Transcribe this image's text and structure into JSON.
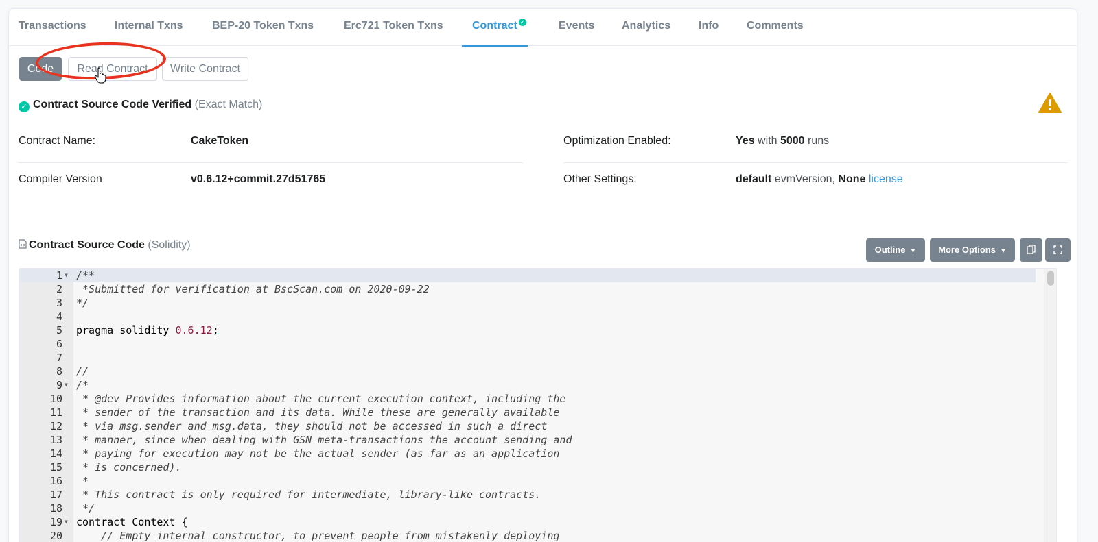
{
  "tabs": [
    {
      "label": "Transactions"
    },
    {
      "label": "Internal Txns"
    },
    {
      "label": "BEP-20 Token Txns"
    },
    {
      "label": "Erc721 Token Txns"
    },
    {
      "label": "Contract"
    },
    {
      "label": "Events"
    },
    {
      "label": "Analytics"
    },
    {
      "label": "Info"
    },
    {
      "label": "Comments"
    }
  ],
  "active_tab": "Contract",
  "sub_buttons": {
    "code": "Code",
    "read": "Read Contract",
    "write": "Write Contract"
  },
  "verified": {
    "title": "Contract Source Code Verified",
    "match": "(Exact Match)"
  },
  "info": {
    "contract_name_label": "Contract Name:",
    "contract_name": "CakeToken",
    "compiler_label": "Compiler Version",
    "compiler": "v0.6.12+commit.27d51765",
    "optimization_label": "Optimization Enabled:",
    "optimization_yes": "Yes",
    "optimization_with": "with",
    "optimization_runs": "5000",
    "optimization_runs_word": "runs",
    "other_label": "Other Settings:",
    "other_default": "default",
    "other_evm": "evmVersion,",
    "other_none": "None",
    "other_license": "license"
  },
  "source": {
    "title": "Contract Source Code",
    "lang": "(Solidity)",
    "outline": "Outline",
    "more_options": "More Options"
  },
  "code_lines": [
    {
      "n": "1",
      "text": "/**",
      "fold": true
    },
    {
      "n": "2",
      "text": " *Submitted for verification at BscScan.com on 2020-09-22"
    },
    {
      "n": "3",
      "text": "*/"
    },
    {
      "n": "4",
      "text": ""
    },
    {
      "n": "5",
      "text": "pragma solidity 0.6.12;"
    },
    {
      "n": "6",
      "text": ""
    },
    {
      "n": "7",
      "text": ""
    },
    {
      "n": "8",
      "text": "//"
    },
    {
      "n": "9",
      "text": "/*",
      "fold": true
    },
    {
      "n": "10",
      "text": " * @dev Provides information about the current execution context, including the"
    },
    {
      "n": "11",
      "text": " * sender of the transaction and its data. While these are generally available"
    },
    {
      "n": "12",
      "text": " * via msg.sender and msg.data, they should not be accessed in such a direct"
    },
    {
      "n": "13",
      "text": " * manner, since when dealing with GSN meta-transactions the account sending and"
    },
    {
      "n": "14",
      "text": " * paying for execution may not be the actual sender (as far as an application"
    },
    {
      "n": "15",
      "text": " * is concerned)."
    },
    {
      "n": "16",
      "text": " *"
    },
    {
      "n": "17",
      "text": " * This contract is only required for intermediate, library-like contracts."
    },
    {
      "n": "18",
      "text": " */"
    },
    {
      "n": "19",
      "text": "contract Context {",
      "fold": true
    },
    {
      "n": "20",
      "text": "    // Empty internal constructor, to prevent people from mistakenly deploying"
    }
  ],
  "colors": {
    "accent": "#3498db",
    "success": "#00c9a7",
    "warning": "#de9b00",
    "annotation": "#e8331f"
  }
}
